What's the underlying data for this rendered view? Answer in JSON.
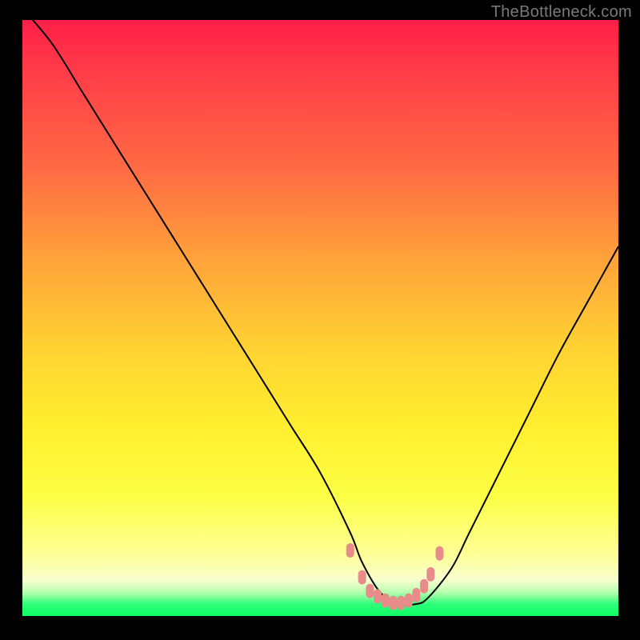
{
  "watermark": "TheBottleneck.com",
  "colors": {
    "frame": "#000000",
    "curve": "#000000",
    "marker": "#e88b8b",
    "marker_stroke": "#d66",
    "gradient_top": "#ff1f47",
    "gradient_bottom": "#0eff66"
  },
  "chart_data": {
    "type": "line",
    "title": "",
    "xlabel": "",
    "ylabel": "",
    "xlim": [
      0,
      100
    ],
    "ylim": [
      0,
      100
    ],
    "series": [
      {
        "name": "bottleneck-curve",
        "x": [
          0,
          5,
          10,
          15,
          20,
          25,
          30,
          35,
          40,
          45,
          50,
          55,
          57,
          60,
          63,
          66,
          68,
          72,
          75,
          80,
          85,
          90,
          95,
          100
        ],
        "y": [
          102,
          96,
          88,
          80,
          72,
          64,
          56,
          48,
          40,
          32,
          24,
          14,
          9,
          4,
          2,
          2,
          3,
          8,
          14,
          24,
          34,
          44,
          53,
          62
        ]
      }
    ],
    "markers": {
      "name": "marker-band",
      "x": [
        55.0,
        57.0,
        58.3,
        59.6,
        60.9,
        62.2,
        63.5,
        64.8,
        66.1,
        67.4,
        68.5,
        70.0
      ],
      "y": [
        11,
        6.5,
        4.2,
        3.3,
        2.6,
        2.2,
        2.2,
        2.6,
        3.5,
        5.0,
        7.0,
        10.5
      ]
    }
  }
}
